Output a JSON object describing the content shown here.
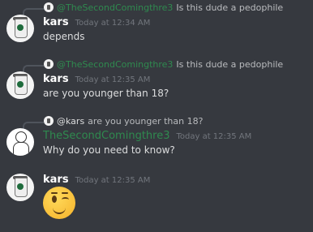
{
  "messages": [
    {
      "reply": {
        "author": "@TheSecondComingthre3",
        "text": "Is this dude a pedophile"
      },
      "username": "kars",
      "timestamp": "Today at 12:34 AM",
      "content": "depends"
    },
    {
      "reply": {
        "author": "@TheSecondComingthre3",
        "text": "Is this dude a pedophile"
      },
      "username": "kars",
      "timestamp": "Today at 12:35 AM",
      "content": "are you younger than 18?"
    },
    {
      "reply": {
        "author": "@kars",
        "text": "are you younger than 18?"
      },
      "username": "TheSecondComingthre3",
      "timestamp": "Today at 12:35 AM",
      "content": "Why do you need to know?"
    },
    {
      "username": "kars",
      "timestamp": "Today at 12:35 AM",
      "content_emoji": "winking-face"
    }
  ],
  "colors": {
    "background": "#36393f",
    "username_default": "#ffffff",
    "username_role": "#2f8a4f",
    "timestamp": "#72767d",
    "reply_text": "#b9bbbe"
  }
}
